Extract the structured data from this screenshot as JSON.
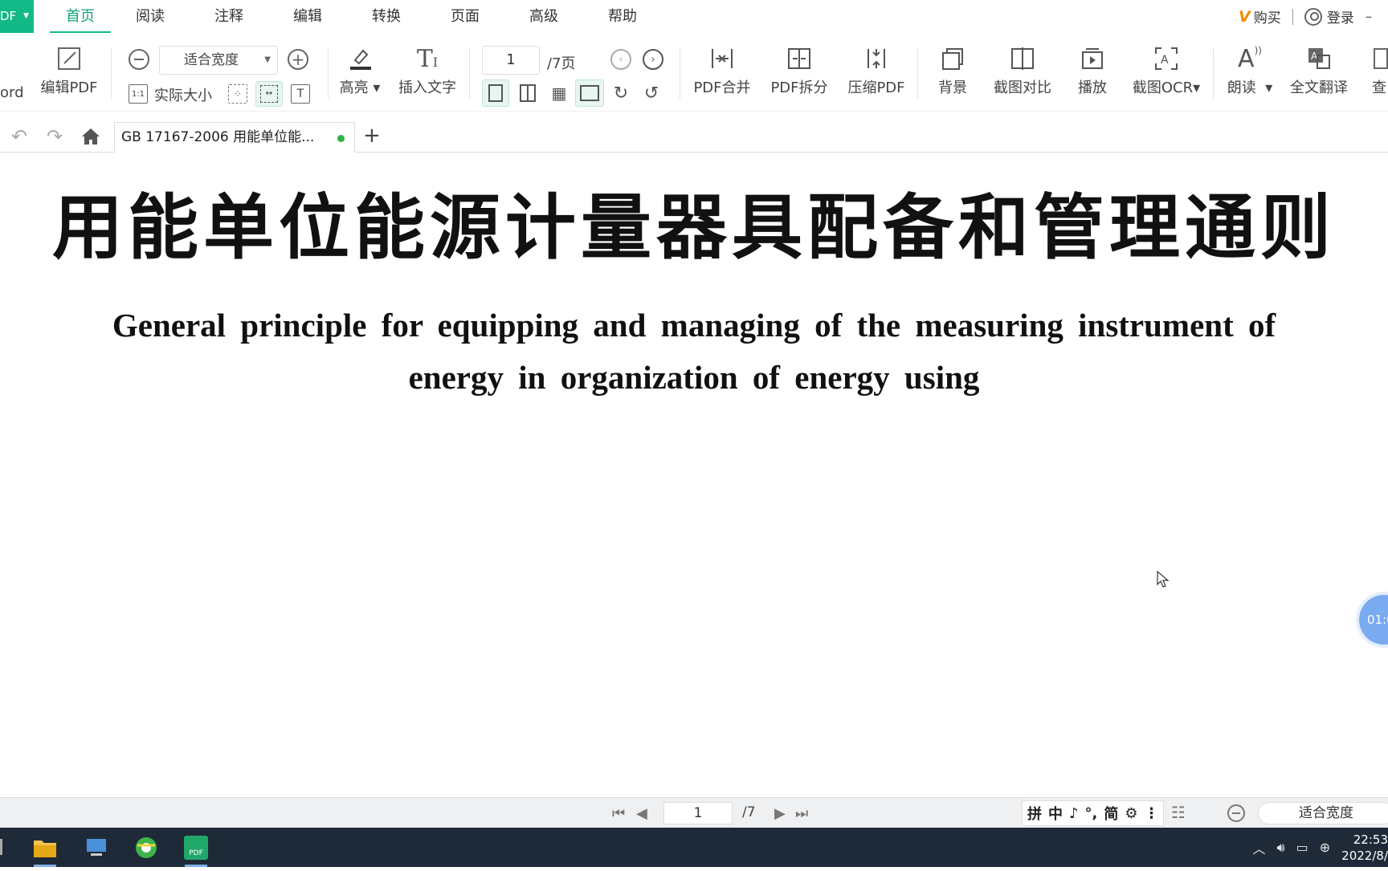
{
  "app": {
    "badge": "DF",
    "menu_tabs": [
      "首页",
      "阅读",
      "注释",
      "编辑",
      "转换",
      "页面",
      "高级",
      "帮助"
    ],
    "active_tab": "首页",
    "buy_label": "购买",
    "login_label": "登录"
  },
  "ribbon": {
    "cut_label": "ord",
    "edit_pdf": "编辑PDF",
    "zoom_value": "适合宽度",
    "actual_size": "实际大小",
    "highlight": "高亮",
    "insert_text": "插入文字",
    "page_value": "1",
    "page_total": "/7页",
    "pdf_merge": "PDF合并",
    "pdf_split": "PDF拆分",
    "compress_pdf": "压缩PDF",
    "background": "背景",
    "screenshot_compare": "截图对比",
    "play": "播放",
    "screenshot_ocr": "截图OCR",
    "read_aloud": "朗读",
    "full_translate": "全文翻译",
    "cut_right": "查"
  },
  "tabs": {
    "doc_tab_title": "GB 17167-2006 用能单位能..."
  },
  "document": {
    "title_cn": "用能单位能源计量器具配备和管理通则",
    "title_en_line1": "General principle for equipping and managing of the measuring instrument of",
    "title_en_line2": "energy in organization of energy using",
    "timer": "01:0"
  },
  "statusbar": {
    "page_value": "1",
    "page_total": "/7",
    "ime_items": [
      "拼",
      "中",
      "♪",
      "°,",
      "简",
      "⚙",
      "⋮"
    ],
    "zoom_value": "适合宽度"
  },
  "taskbar": {
    "time": "22:53",
    "date": "2022/8/"
  }
}
